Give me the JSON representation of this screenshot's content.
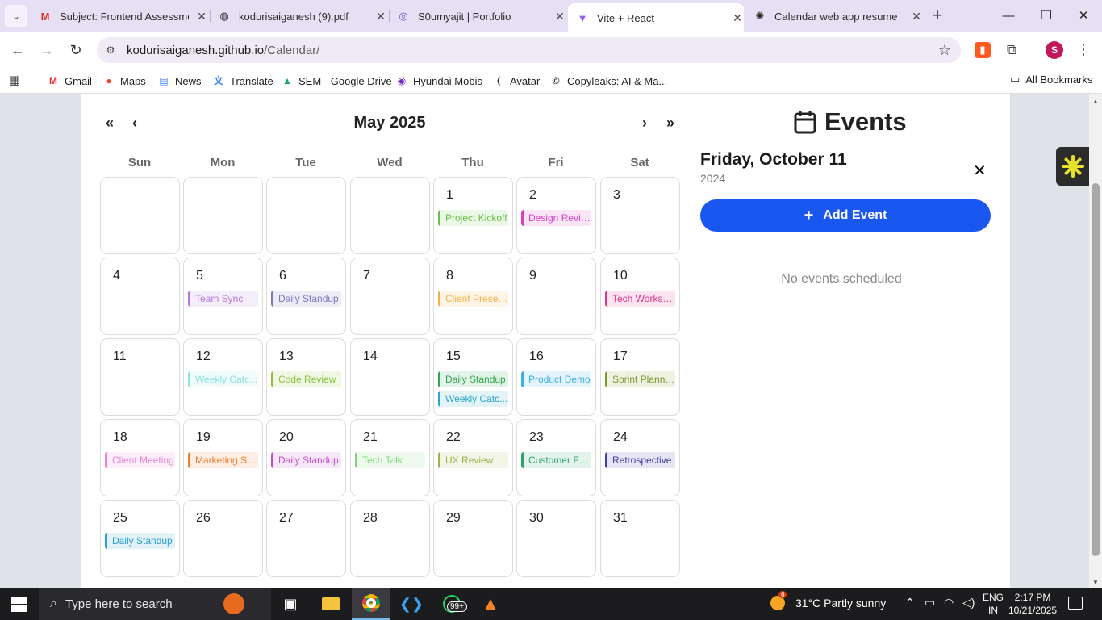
{
  "browser": {
    "tabs": [
      {
        "title": "Subject: Frontend Assessment",
        "favicon": "gmail-icon"
      },
      {
        "title": "kodurisaiganesh (9).pdf",
        "favicon": "globe-icon"
      },
      {
        "title": "S0umyajit | Portfolio",
        "favicon": "portfolio-icon"
      },
      {
        "title": "Vite + React",
        "favicon": "vite-icon",
        "active": true
      },
      {
        "title": "Calendar web app resume",
        "favicon": "openai-icon"
      }
    ],
    "url_host": "kodurisaiganesh.github.io",
    "url_path": "/Calendar/",
    "avatar_letter": "S",
    "bookmarks": [
      "Gmail",
      "Maps",
      "News",
      "Translate",
      "SEM - Google Drive",
      "Hyundai Mobis",
      "Avatar",
      "Copyleaks: AI & Ma..."
    ],
    "all_bookmarks": "All Bookmarks"
  },
  "calendar": {
    "month_title": "May 2025",
    "weekdays": [
      "Sun",
      "Mon",
      "Tue",
      "Wed",
      "Thu",
      "Fri",
      "Sat"
    ],
    "nav": {
      "prev_year": "«",
      "prev_month": "‹",
      "next_month": "›",
      "next_year": "»"
    },
    "weeks": [
      [
        {
          "day": ""
        },
        {
          "day": ""
        },
        {
          "day": ""
        },
        {
          "day": ""
        },
        {
          "day": "1",
          "events": [
            {
              "label": "Project Kickoff",
              "color": "#6cc04a"
            }
          ]
        },
        {
          "day": "2",
          "events": [
            {
              "label": "Design Review",
              "color": "#d63fc6"
            }
          ]
        },
        {
          "day": "3"
        }
      ],
      [
        {
          "day": "4"
        },
        {
          "day": "5",
          "events": [
            {
              "label": "Team Sync",
              "color": "#b779d9"
            }
          ]
        },
        {
          "day": "6",
          "events": [
            {
              "label": "Daily Standup",
              "color": "#7a79c2"
            }
          ]
        },
        {
          "day": "7"
        },
        {
          "day": "8",
          "events": [
            {
              "label": "Client Presen...",
              "color": "#f4b24c"
            }
          ]
        },
        {
          "day": "9"
        },
        {
          "day": "10",
          "events": [
            {
              "label": "Tech Worksh...",
              "color": "#e3328c"
            }
          ]
        }
      ],
      [
        {
          "day": "11"
        },
        {
          "day": "12",
          "events": [
            {
              "label": "Weekly Catc...",
              "color": "#8fe3e0"
            }
          ]
        },
        {
          "day": "13",
          "events": [
            {
              "label": "Code Review",
              "color": "#8ac23a"
            }
          ]
        },
        {
          "day": "14"
        },
        {
          "day": "15",
          "events": [
            {
              "label": "Daily Standup",
              "color": "#2fa84f"
            },
            {
              "label": "Weekly Catc...",
              "color": "#2aa7c9"
            }
          ]
        },
        {
          "day": "16",
          "events": [
            {
              "label": "Product Demo",
              "color": "#3ab0e6"
            }
          ]
        },
        {
          "day": "17",
          "events": [
            {
              "label": "Sprint Planni...",
              "color": "#7a9a2a"
            }
          ]
        }
      ],
      [
        {
          "day": "18",
          "events": [
            {
              "label": "Client Meeting",
              "color": "#e882d6"
            }
          ]
        },
        {
          "day": "19",
          "events": [
            {
              "label": "Marketing Sy...",
              "color": "#f07a2a"
            }
          ]
        },
        {
          "day": "20",
          "events": [
            {
              "label": "Daily Standup",
              "color": "#c64fd0"
            }
          ]
        },
        {
          "day": "21",
          "events": [
            {
              "label": "Tech Talk",
              "color": "#7ed67a"
            }
          ]
        },
        {
          "day": "22",
          "events": [
            {
              "label": "UX Review",
              "color": "#9ab34a"
            }
          ]
        },
        {
          "day": "23",
          "events": [
            {
              "label": "Customer Fe...",
              "color": "#2aa86a"
            }
          ]
        },
        {
          "day": "24",
          "events": [
            {
              "label": "Retrospective",
              "color": "#3f3fa6"
            }
          ]
        }
      ],
      [
        {
          "day": "25",
          "events": [
            {
              "label": "Daily Standup",
              "color": "#2a9fd0"
            }
          ]
        },
        {
          "day": "26"
        },
        {
          "day": "27"
        },
        {
          "day": "28"
        },
        {
          "day": "29"
        },
        {
          "day": "30"
        },
        {
          "day": "31"
        }
      ]
    ]
  },
  "events_panel": {
    "heading": "Events",
    "date_title": "Friday, October 11",
    "year": "2024",
    "close": "✕",
    "add_button": "Add Event",
    "empty_text": "No events scheduled"
  },
  "taskbar": {
    "search_placeholder": "Type here to search",
    "badge": "99+",
    "weather": "31°C  Partly sunny",
    "weather_badge": "6",
    "lang_line1": "ENG",
    "lang_line2": "IN",
    "time": "2:17 PM",
    "date": "10/21/2025"
  }
}
